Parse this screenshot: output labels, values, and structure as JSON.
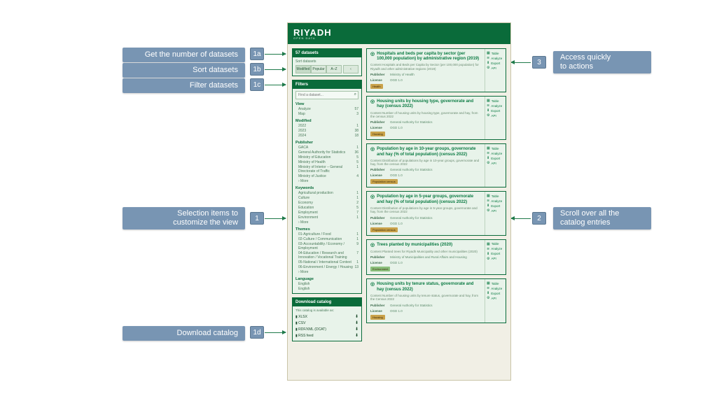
{
  "callouts": {
    "c1a": "Get the number of datasets",
    "c1b": "Sort datasets",
    "c1c": "Filter datasets",
    "c1": "Selection items to\ncustomize the view",
    "c1d": "Download catalog",
    "c2": "Scroll over all the\ncatalog entries",
    "c3": "Access quickly\nto actions",
    "b1a": "1a",
    "b1b": "1b",
    "b1c": "1c",
    "b1": "1",
    "b1d": "1d",
    "b2": "2",
    "b3": "3"
  },
  "brand": {
    "name": "RIYADH",
    "sub": "OPEN DATA"
  },
  "count_header": "57 datasets",
  "sort": {
    "label": "Sort datasets",
    "tabs": [
      "Modified",
      "Popular",
      "A–Z"
    ],
    "pager": "‹"
  },
  "filters_header": "Filters",
  "search": {
    "placeholder": "Find a dataset..."
  },
  "facets": [
    {
      "heading": "View",
      "items": [
        {
          "label": "Analyze",
          "count": "57"
        },
        {
          "label": "Map",
          "count": "3"
        }
      ]
    },
    {
      "heading": "Modified",
      "items": [
        {
          "label": "2022",
          "count": "1"
        },
        {
          "label": "2023",
          "count": "38"
        },
        {
          "label": "2024",
          "count": "18"
        }
      ]
    },
    {
      "heading": "Publisher",
      "items": [
        {
          "label": "GACA",
          "count": "1"
        },
        {
          "label": "General Authority for Statistics",
          "count": "36"
        },
        {
          "label": "Ministry of Education",
          "count": "5"
        },
        {
          "label": "Ministry of Health",
          "count": "5"
        },
        {
          "label": "Ministry of Interior – General Directorate of Traffic",
          "count": "1"
        },
        {
          "label": "Ministry of Justice",
          "count": "4"
        },
        {
          "label": "› More",
          "count": ""
        }
      ]
    },
    {
      "heading": "Keywords",
      "items": [
        {
          "label": "Agricultural production",
          "count": "1"
        },
        {
          "label": "Culture",
          "count": "1"
        },
        {
          "label": "Economy",
          "count": "2"
        },
        {
          "label": "Education",
          "count": "5"
        },
        {
          "label": "Employment",
          "count": "7"
        },
        {
          "label": "Environment",
          "count": "1"
        },
        {
          "label": "› More",
          "count": ""
        }
      ]
    },
    {
      "heading": "Themes",
      "items": [
        {
          "label": "01-Agriculture / Food",
          "count": "1"
        },
        {
          "label": "02-Culture / Communication",
          "count": "1"
        },
        {
          "label": "03-Accountability / Economy / Employment",
          "count": "9"
        },
        {
          "label": "04-Education / Research and Innovation / Vocational Training",
          "count": "7"
        },
        {
          "label": "05-National / International Context",
          "count": "1"
        },
        {
          "label": "06-Environment / Energy / Housing",
          "count": "13"
        },
        {
          "label": "› More",
          "count": ""
        }
      ]
    },
    {
      "heading": "Language",
      "items": [
        {
          "label": "English",
          "count": ""
        },
        {
          "label": "English",
          "count": ""
        }
      ]
    }
  ],
  "download": {
    "header": "Download catalog",
    "intro": "This catalog is available as:",
    "formats": [
      "XLSX",
      "CSV",
      "RDF/XML (DCAT)",
      "RSS feed"
    ]
  },
  "actions": {
    "table": "Table",
    "analyze": "Analyze",
    "export": "Export",
    "api": "API"
  },
  "meta_labels": {
    "publisher": "Publisher",
    "license": "License"
  },
  "datasets": [
    {
      "title": "Hospitals and beds per capita by sector (per 100,000 population) by administrative region (2019)",
      "desc": "Content Hospitals and Beds per Capita by Sector (per 100,000 population) for Riyadh and other administrative regions (2019)",
      "publisher": "Ministry of Health",
      "license": "OGD 1.0",
      "tag": "Health",
      "tagClass": ""
    },
    {
      "title": "Housing units by housing type, governorate and hay (census 2022)",
      "desc": "Content Number of housing units by housing type, governorate and hay, from the census 2022",
      "publisher": "General Authority for Statistics",
      "license": "OGD 1.0",
      "tag": "Housing",
      "tagClass": ""
    },
    {
      "title": "Population by age in 10-year groups, governorate and hay (% of total population) (census 2022)",
      "desc": "Content Distribution of populations by age in 10-year groups, governorate and hay, from the census 2022",
      "publisher": "General Authority for Statistics",
      "license": "OGD 1.0",
      "tag": "Population census",
      "tagClass": ""
    },
    {
      "title": "Population by age in 5-year groups, governorate and hay (% of total population) (census 2022)",
      "desc": "Content Distribution of populations by age in 5-year groups, governorate and hay, from the census 2022",
      "publisher": "General Authority for Statistics",
      "license": "OGD 1.0",
      "tag": "Population census",
      "tagClass": ""
    },
    {
      "title": "Trees planted by municipalities (2020)",
      "desc": "Content Planted trees for Riyadh Municipality and other municipalities (2020)",
      "publisher": "Ministry of Municipalities and Rural Affairs and Housing",
      "license": "OGD 1.0",
      "tag": "Environment",
      "tagClass": "alt"
    },
    {
      "title": "Housing units by tenure status, governorate and hay (census 2022)",
      "desc": "Content Number of housing units by tenure status, governorate and hay, from the Census 2022",
      "publisher": "General Authority for Statistics",
      "license": "OGD 1.0",
      "tag": "Housing",
      "tagClass": ""
    }
  ]
}
